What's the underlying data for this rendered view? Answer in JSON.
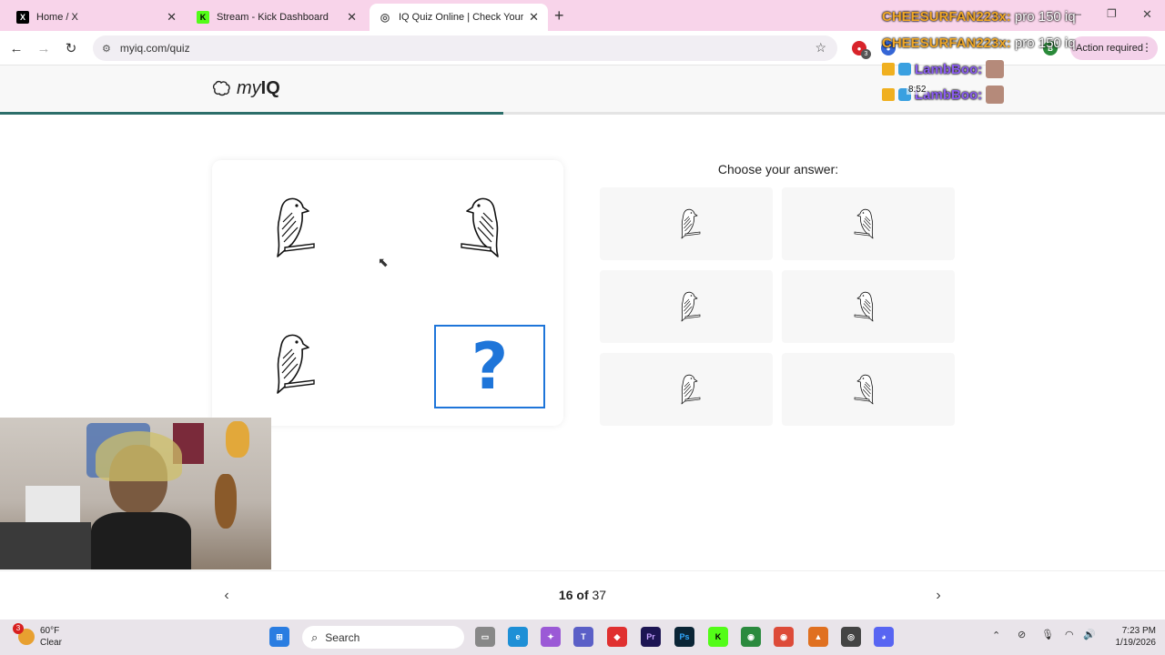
{
  "browser": {
    "tabs": [
      {
        "title": "Home / X",
        "icon": "x-logo-icon",
        "active": false
      },
      {
        "title": "Stream - Kick Dashboard",
        "icon": "kick-logo-icon",
        "active": false
      },
      {
        "title": "IQ Quiz Online | Check Your IQ",
        "icon": "globe-icon",
        "active": true
      }
    ],
    "new_tab_label": "+",
    "url": "myiq.com/quiz",
    "action_required": "Action required",
    "extension_badge": "3"
  },
  "site": {
    "logo_prefix": "my",
    "logo_suffix": "IQ",
    "progress": 0.432
  },
  "quiz": {
    "question_mark": "?",
    "choose_label": "Choose your answer:",
    "current": "16",
    "of_label": "of",
    "total": "37"
  },
  "chat": [
    {
      "user": "CHEESURFAN223x:",
      "message": "pro 150 iq"
    },
    {
      "user": "CHEESURFAN223x:",
      "message": "pro 150 iq"
    },
    {
      "user": "LambBoo:",
      "message": ""
    },
    {
      "user": "LambBoo:",
      "message": ""
    }
  ],
  "overlay_timer": "8:52",
  "taskbar": {
    "weather_temp": "60°F",
    "weather_desc": "Clear",
    "weather_badge": "3",
    "search_label": "Search",
    "time": "7:23 PM",
    "date": "1/19/2026"
  },
  "colors": {
    "accent": "#1e75d9",
    "progress": "#2c6e6a",
    "tabstrip": "#f8d4ea"
  }
}
